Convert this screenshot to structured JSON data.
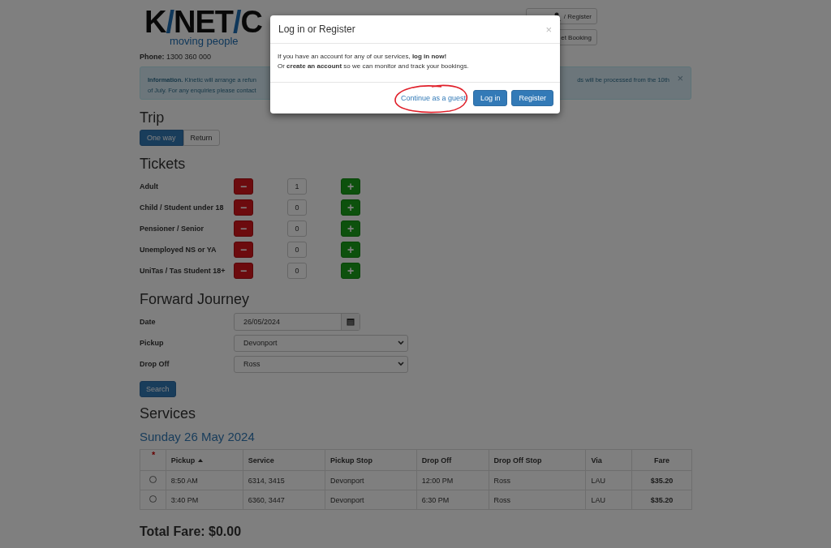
{
  "header": {
    "logo": [
      {
        "text": "K",
        "accent": false
      },
      {
        "text": "/",
        "accent": true
      },
      {
        "text": "NET",
        "accent": false
      },
      {
        "text": "/",
        "accent": true
      },
      {
        "text": "C",
        "accent": false
      }
    ],
    "tagline": "moving people",
    "phone_label": "Phone:",
    "phone": "1300 360 000",
    "buttons": [
      {
        "label": "/ Register"
      },
      {
        "label": "et Booking"
      }
    ]
  },
  "alert": {
    "left_lines": [
      "**Information.** Kinetic will arrange a refun",
      "of July. For any enquiries please contact"
    ],
    "right_lines": [
      "ds will be processed from the 10th"
    ],
    "close": "×"
  },
  "trip": {
    "title": "Trip",
    "options": [
      {
        "label": "One way",
        "selected": true
      },
      {
        "label": "Return",
        "selected": false
      }
    ]
  },
  "tickets": {
    "title": "Tickets",
    "minus": "−",
    "plus": "+",
    "rows": [
      {
        "label": "Adult",
        "count": "1"
      },
      {
        "label": "Child / Student under 18",
        "count": "0"
      },
      {
        "label": "Pensioner / Senior",
        "count": "0"
      },
      {
        "label": "Unemployed NS or YA",
        "count": "0"
      },
      {
        "label": "UniTas / Tas Student 18+",
        "count": "0"
      }
    ]
  },
  "journey": {
    "title": "Forward Journey",
    "date_label": "Date",
    "date": "26/05/2024",
    "pickup_label": "Pickup",
    "pickup": "Devonport",
    "dropoff_label": "Drop Off",
    "dropoff": "Ross",
    "search": "Search"
  },
  "services": {
    "title": "Services",
    "date_heading": "Sunday 26 May 2024",
    "required": "*",
    "columns": [
      {
        "label": "Pickup",
        "sorted": true
      },
      {
        "label": "Service",
        "sorted": false
      },
      {
        "label": "Pickup Stop",
        "sorted": false
      },
      {
        "label": "Drop Off",
        "sorted": false
      },
      {
        "label": "Drop Off Stop",
        "sorted": false
      },
      {
        "label": "Via",
        "sorted": false
      },
      {
        "label": "Fare",
        "sorted": false
      }
    ],
    "rows": [
      {
        "selected": false,
        "cells": [
          "8:50 AM",
          "6314, 3415",
          "Devonport",
          "12:00 PM",
          "Ross",
          "LAU",
          "$35.20"
        ]
      },
      {
        "selected": false,
        "cells": [
          "3:40 PM",
          "6360, 3447",
          "Devonport",
          "6:30 PM",
          "Ross",
          "LAU",
          "$35.20"
        ]
      }
    ]
  },
  "total": "Total Fare: $0.00",
  "modal": {
    "title": "Log in or Register",
    "close": "×",
    "body": [
      "If you have an account for any of our services, **log in now!**",
      "Or **create an account** so we can monitor and track your bookings."
    ],
    "guest_link": "Continue as a guest",
    "guest_circled": true,
    "buttons": [
      "Log in",
      "Register"
    ]
  }
}
